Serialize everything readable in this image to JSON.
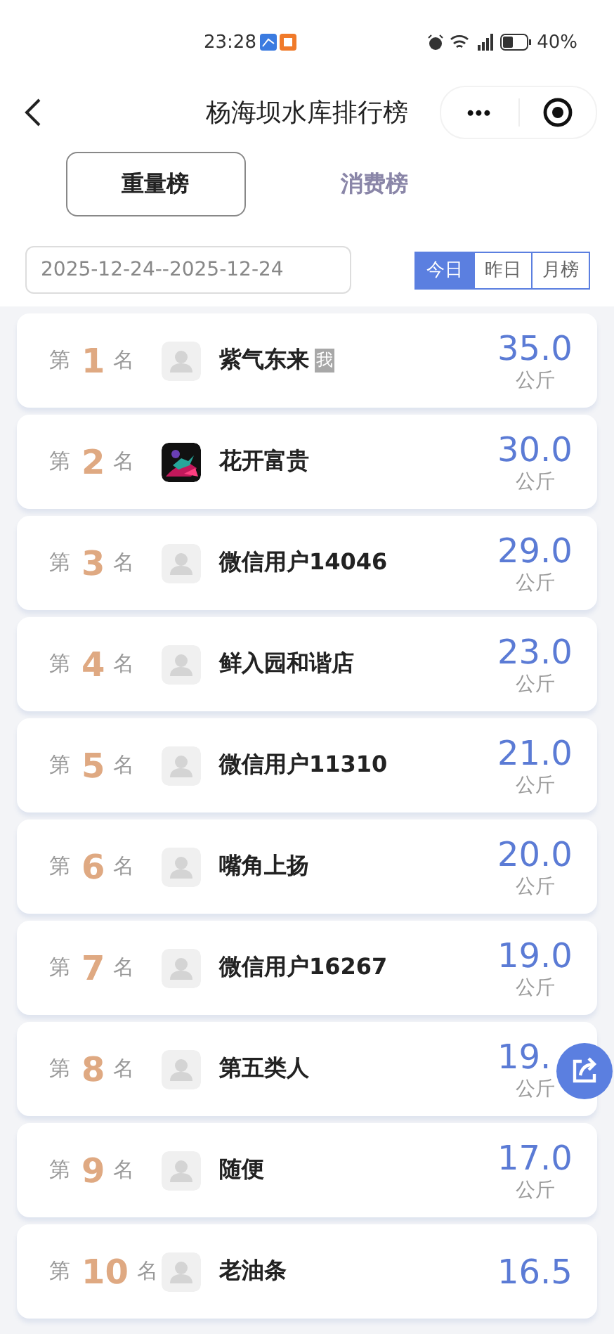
{
  "status_bar": {
    "time": "23:28",
    "battery": "40%"
  },
  "nav": {
    "title": "杨海坝水库排行榜",
    "more": "•••"
  },
  "tabs": [
    {
      "label": "重量榜",
      "selected": true
    },
    {
      "label": "消费榜",
      "selected": false
    }
  ],
  "date_range": {
    "value": "2025-12-24--2025-12-24"
  },
  "periods": [
    {
      "label": "今日",
      "selected": true
    },
    {
      "label": "昨日",
      "selected": false
    },
    {
      "label": "月榜",
      "selected": false
    }
  ],
  "ranking": [
    {
      "prefix": "第",
      "rank": "1",
      "suffix": "名",
      "kind": "default",
      "name": "紫气东来",
      "me_badge": "我",
      "value": "35.0",
      "unit": "公斤"
    },
    {
      "prefix": "第",
      "rank": "2",
      "suffix": "名",
      "kind": "picture",
      "name": "花开富贵",
      "value": "30.0",
      "unit": "公斤"
    },
    {
      "prefix": "第",
      "rank": "3",
      "suffix": "名",
      "kind": "default",
      "name": "微信用户14046",
      "value": "29.0",
      "unit": "公斤"
    },
    {
      "prefix": "第",
      "rank": "4",
      "suffix": "名",
      "kind": "default",
      "name": "鲜入园和谐店",
      "value": "23.0",
      "unit": "公斤"
    },
    {
      "prefix": "第",
      "rank": "5",
      "suffix": "名",
      "kind": "default",
      "name": "微信用户11310",
      "value": "21.0",
      "unit": "公斤"
    },
    {
      "prefix": "第",
      "rank": "6",
      "suffix": "名",
      "kind": "default",
      "name": "嘴角上扬",
      "value": "20.0",
      "unit": "公斤"
    },
    {
      "prefix": "第",
      "rank": "7",
      "suffix": "名",
      "kind": "default",
      "name": "微信用户16267",
      "value": "19.0",
      "unit": "公斤"
    },
    {
      "prefix": "第",
      "rank": "8",
      "suffix": "名",
      "kind": "default",
      "name": "第五类人",
      "value": "19.",
      "unit": "公斤"
    },
    {
      "prefix": "第",
      "rank": "9",
      "suffix": "名",
      "kind": "default",
      "name": "随便",
      "value": "17.0",
      "unit": "公斤"
    },
    {
      "prefix": "第",
      "rank": "10",
      "suffix": "名",
      "kind": "default",
      "name": "老油条",
      "value": "16.5"
    }
  ]
}
